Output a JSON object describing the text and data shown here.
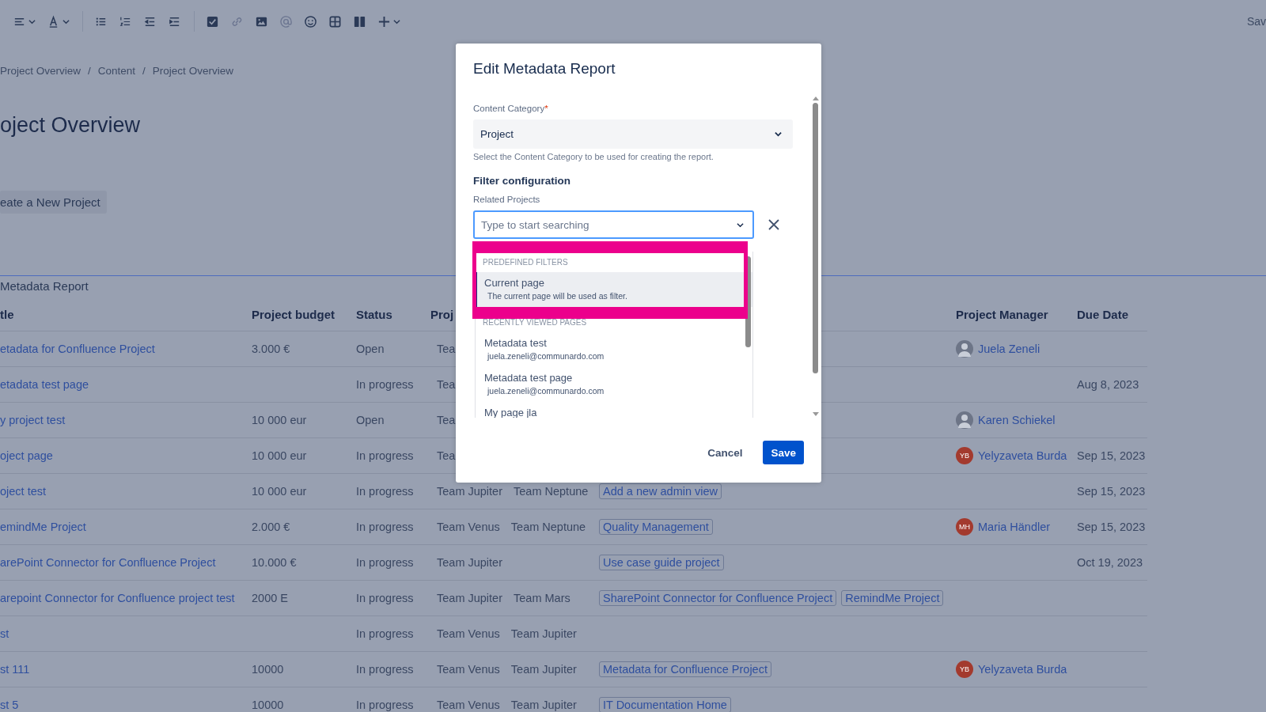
{
  "toolbar": {
    "save_label": "Sav"
  },
  "breadcrumbs": [
    "Project Overview",
    "Content",
    "Project Overview"
  ],
  "breadcrumb_separator": "/",
  "page_title": "oject Overview",
  "create_button": "eate a New Project",
  "report": {
    "title": "Metadata Report",
    "columns": [
      {
        "kind": "title",
        "label": "tle"
      },
      {
        "kind": "budget",
        "label": "Project budget"
      },
      {
        "kind": "status",
        "label": "Status"
      },
      {
        "kind": "teams",
        "label": "Proj"
      },
      {
        "kind": "manager",
        "label": "Project Manager"
      },
      {
        "kind": "due",
        "label": "Due Date"
      }
    ],
    "rows": [
      {
        "title": "etadata for Confluence Project",
        "budget": "3.000 €",
        "status": "Open",
        "teams": [
          "Tea"
        ],
        "related": [],
        "manager": {
          "name": "Juela Zeneli",
          "kind": "photo"
        },
        "due": ""
      },
      {
        "title": "etadata test page",
        "budget": "",
        "status": "In progress",
        "teams": [
          "Tea"
        ],
        "related": [],
        "due": "Aug 8, 2023"
      },
      {
        "title": "y project test",
        "budget": "10 000 eur",
        "status": "Open",
        "teams": [
          "Tea"
        ],
        "related": [],
        "manager": {
          "name": "Karen Schiekel",
          "kind": "photo"
        },
        "due": ""
      },
      {
        "title": "oject page",
        "budget": "10 000 eur",
        "status": "In progress",
        "teams": [
          "Tea"
        ],
        "related": [],
        "manager": {
          "name": "Yelyzaveta Burda",
          "kind": "initials",
          "initials": "YB"
        },
        "due": "Sep 15, 2023"
      },
      {
        "title": "oject test",
        "budget": "10 000 eur",
        "status": "In progress",
        "teams": [
          "Team Jupiter",
          "Team Neptune"
        ],
        "related": [
          "Add a new admin view"
        ],
        "due": "Sep 15, 2023"
      },
      {
        "title": "emindMe Project",
        "budget": "2.000 €",
        "status": "In progress",
        "teams": [
          "Team Venus",
          "Team Neptune"
        ],
        "related": [
          "Quality Management"
        ],
        "manager": {
          "name": "Maria Händler",
          "kind": "initials",
          "initials": "MH"
        },
        "due": "Sep 15, 2023"
      },
      {
        "title": "arePoint Connector for Confluence Project",
        "budget": "10.000 €",
        "status": "In progress",
        "teams": [
          "Team Jupiter"
        ],
        "related": [
          "Use case guide project"
        ],
        "due": "Oct 19, 2023"
      },
      {
        "title": "arepoint Connector for Confluence project test",
        "budget": "2000 E",
        "status": "In progress",
        "teams": [
          "Team Jupiter",
          "Team Mars"
        ],
        "related": [
          "SharePoint Connector for Confluence Project",
          "RemindMe Project"
        ],
        "due": ""
      },
      {
        "title": "st",
        "budget": "",
        "status": "In progress",
        "teams": [
          "Team Venus",
          "Team Jupiter"
        ],
        "related": [],
        "due": ""
      },
      {
        "title": "st 111",
        "budget": "10000",
        "status": "In progress",
        "teams": [
          "Team Venus",
          "Team Jupiter"
        ],
        "related": [
          "Metadata for Confluence Project"
        ],
        "manager": {
          "name": "Yelyzaveta Burda",
          "kind": "initials",
          "initials": "YB"
        },
        "due": ""
      },
      {
        "title": "st 5",
        "budget": "10000",
        "status": "In progress",
        "teams": [
          "Team Venus",
          "Team Jupiter"
        ],
        "related": [
          "IT Documentation Home"
        ],
        "due": ""
      }
    ]
  },
  "modal": {
    "title": "Edit Metadata Report",
    "category_label": "Content Category",
    "required_mark": "*",
    "category_value": "Project",
    "category_help": "Select the Content Category to be used for creating the report.",
    "filter_heading": "Filter configuration",
    "related_label": "Related Projects",
    "related_placeholder": "Type to start searching",
    "dropdown": [
      {
        "heading": "PREDEFINED FILTERS",
        "options": [
          {
            "title": "Current page",
            "subtitle": "The current page will be used as filter.",
            "selected": true,
            "marked": true
          }
        ]
      },
      {
        "heading": "RECENTLY VIEWED PAGES",
        "options": [
          {
            "title": "Metadata test",
            "subtitle": "juela.zeneli@communardo.com",
            "selected": false,
            "marked": false
          },
          {
            "title": "Metadata test page",
            "subtitle": "juela.zeneli@communardo.com",
            "selected": false,
            "marked": false
          },
          {
            "title": "My page jla",
            "selected": false,
            "marked": false
          }
        ]
      }
    ],
    "buttons": [
      {
        "label": "Cancel",
        "kind": "subtle"
      },
      {
        "label": "Save",
        "kind": "primary"
      }
    ]
  }
}
